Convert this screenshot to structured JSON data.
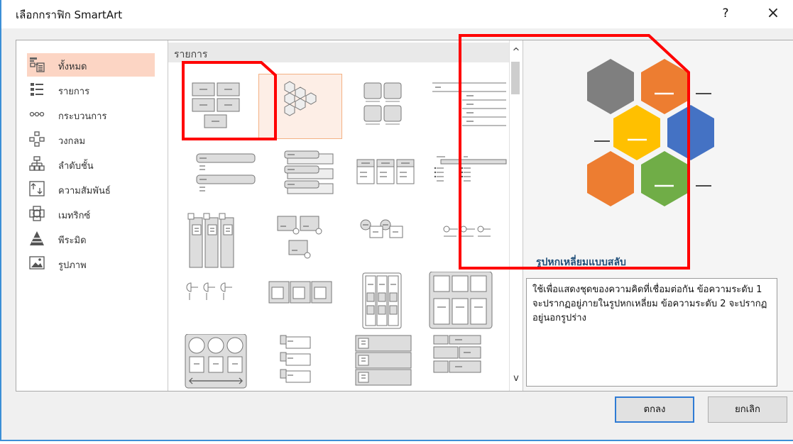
{
  "window": {
    "title": "เลือกกราฟิก SmartArt",
    "help_label": "?",
    "close_label": "×"
  },
  "categories": [
    {
      "label": "ทั้งหมด",
      "icon": "all-icon",
      "selected": true
    },
    {
      "label": "รายการ",
      "icon": "list-icon"
    },
    {
      "label": "กระบวนการ",
      "icon": "process-icon"
    },
    {
      "label": "วงกลม",
      "icon": "cycle-icon"
    },
    {
      "label": "ลำดับชั้น",
      "icon": "hierarchy-icon"
    },
    {
      "label": "ความสัมพันธ์",
      "icon": "relationship-icon"
    },
    {
      "label": "เมทริกซ์",
      "icon": "matrix-icon"
    },
    {
      "label": "พีระมิด",
      "icon": "pyramid-icon"
    },
    {
      "label": "รูปภาพ",
      "icon": "picture-icon"
    }
  ],
  "gallery": {
    "header": "รายการ",
    "selected_layout": "hexagon-alternating",
    "layouts": [
      "basic-block-list",
      "alternating-hexagons",
      "picture-caption-list",
      "lined-list",
      "vertical-bullet-list",
      "vertical-box-list",
      "horizontal-bullet-list",
      "hierarchy-list",
      "table-list",
      "picture-accent-blocks",
      "trapezoid-list",
      "descending-block-list",
      "square-accent-list",
      "picture-accent-process",
      "stacked-list",
      "grouped-list",
      "process-arrows-list",
      "vertical-arrow-list",
      "vertical-block-list",
      "tab-list"
    ]
  },
  "scrollbar": {
    "up": "^",
    "down": "v"
  },
  "preview": {
    "title": "รูปหกเหลี่ยมแบบสลับ",
    "description": "ใช้เพื่อแสดงชุดของความคิดที่เชื่อมต่อกัน ข้อความระดับ 1 จะปรากฏอยู่ภายในรูปหกเหลี่ยม ข้อความระดับ 2 จะปรากฏอยู่นอกรูปร่าง",
    "hex_colors": [
      "#7f7f7f",
      "#ed7d31",
      "#ffc000",
      "#4472c4",
      "#ed7d31",
      "#70ad47"
    ]
  },
  "buttons": {
    "ok": "ตกลง",
    "cancel": "ยกเลิก"
  },
  "annotation_color": "#ff0000"
}
